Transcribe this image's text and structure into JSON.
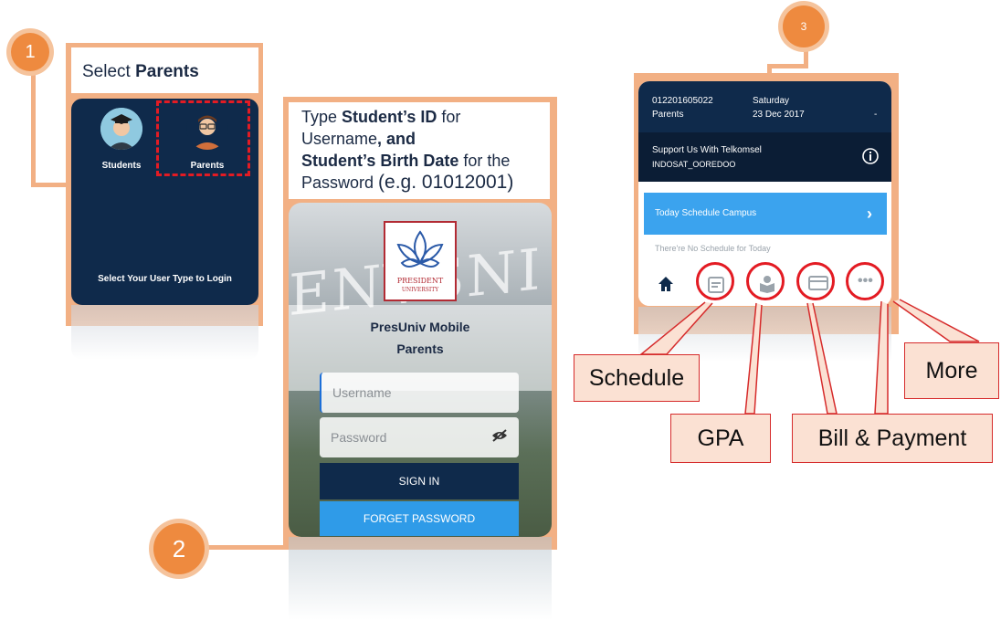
{
  "step1": {
    "badge": "1",
    "title_prefix": "Select",
    "title_bold": "Parents",
    "students_label": "Students",
    "parents_label": "Parents",
    "hint": "Select Your User Type to Login"
  },
  "step2": {
    "badge": "2",
    "inst": {
      "t1": "Type ",
      "b1": "Student’s ID",
      "t2": " for",
      "t3": "Username",
      "t4": ", and",
      "b2": "Student’s Birth Date",
      "t5": " for the",
      "t6": "Password ",
      "t7": "(e.g. 01012001)"
    },
    "building_text": "ENVSNI",
    "logo_line1": "PRESIDENT",
    "logo_line2": "UNIVERSITY",
    "app_name": "PresUniv Mobile",
    "app_sub": "Parents",
    "username_placeholder": "Username",
    "password_placeholder": "Password",
    "signin_label": "SIGN IN",
    "forget_label": "FORGET PASSWORD"
  },
  "step3": {
    "badge": "3",
    "student_id": "012201605022",
    "role": "Parents",
    "day": "Saturday",
    "date": "23 Dec 2017",
    "dash": "-",
    "support_title": "Support Us With Telkomsel",
    "support_sub": "INDOSAT_OOREDOO",
    "today_label": "Today Schedule Campus",
    "no_schedule": "There're No Schedule for Today"
  },
  "callouts": {
    "schedule": "Schedule",
    "gpa": "GPA",
    "bill": "Bill & Payment",
    "more": "More"
  },
  "colors": {
    "accent_orange": "#ee8a3f",
    "navy": "#0f2a4b",
    "blue": "#2f9be8",
    "highlight_red": "#e31b23"
  }
}
